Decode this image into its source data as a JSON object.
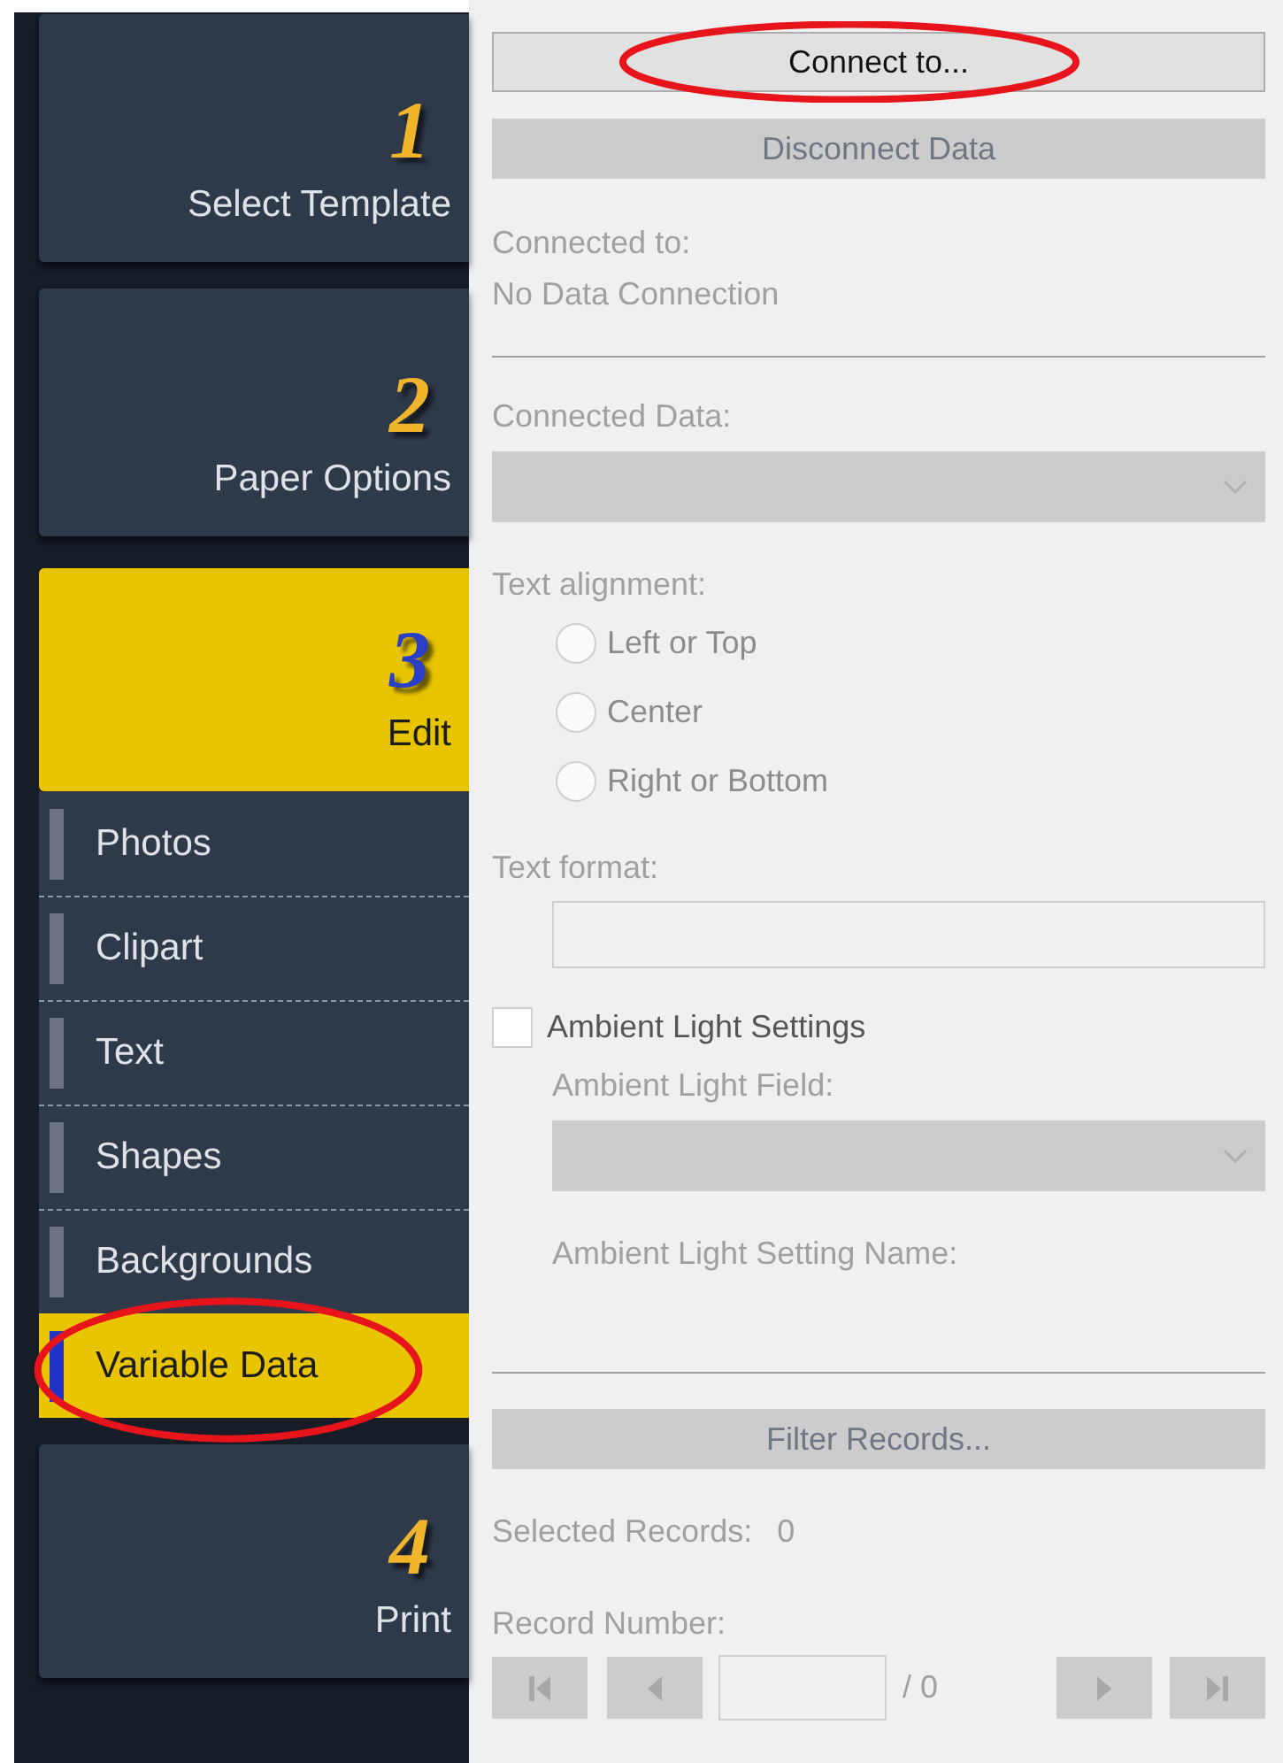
{
  "steps_top": [
    {
      "number": "1",
      "label": "Select Template",
      "selected": false
    },
    {
      "number": "2",
      "label": "Paper Options",
      "selected": false
    },
    {
      "number": "3",
      "label": "Edit",
      "selected": true
    }
  ],
  "edit_items": [
    {
      "label": "Photos",
      "selected": false,
      "highlighted": false
    },
    {
      "label": "Clipart",
      "selected": false,
      "highlighted": false
    },
    {
      "label": "Text",
      "selected": false,
      "highlighted": false
    },
    {
      "label": "Shapes",
      "selected": false,
      "highlighted": false
    },
    {
      "label": "Backgrounds",
      "selected": false,
      "highlighted": false
    },
    {
      "label": "Variable Data",
      "selected": true,
      "highlighted": true
    }
  ],
  "steps_bottom": [
    {
      "number": "4",
      "label": "Print",
      "selected": false
    }
  ],
  "connect_button": {
    "label": "Connect to...",
    "disabled": false,
    "highlighted": true
  },
  "disconnect_button": {
    "label": "Disconnect Data",
    "disabled": true
  },
  "connected_to": {
    "label": "Connected to:",
    "value": "No Data Connection"
  },
  "connected_data": {
    "label": "Connected Data:",
    "disabled": true
  },
  "text_alignment": {
    "label": "Text alignment:",
    "options": [
      {
        "label": "Left or Top",
        "selected": false
      },
      {
        "label": "Center",
        "selected": false
      },
      {
        "label": "Right or Bottom",
        "selected": false
      }
    ]
  },
  "text_format": {
    "label": "Text format:"
  },
  "ambient_light": {
    "label": "Ambient Light Settings",
    "checked": false,
    "field_label": "Ambient Light Field:",
    "name_label": "Ambient Light Setting Name:"
  },
  "filter_button": {
    "label": "Filter Records...",
    "disabled": true
  },
  "selected_records": {
    "label": "Selected Records:",
    "value": "0"
  },
  "record_number": {
    "label": "Record Number:",
    "total": "/ 0"
  }
}
